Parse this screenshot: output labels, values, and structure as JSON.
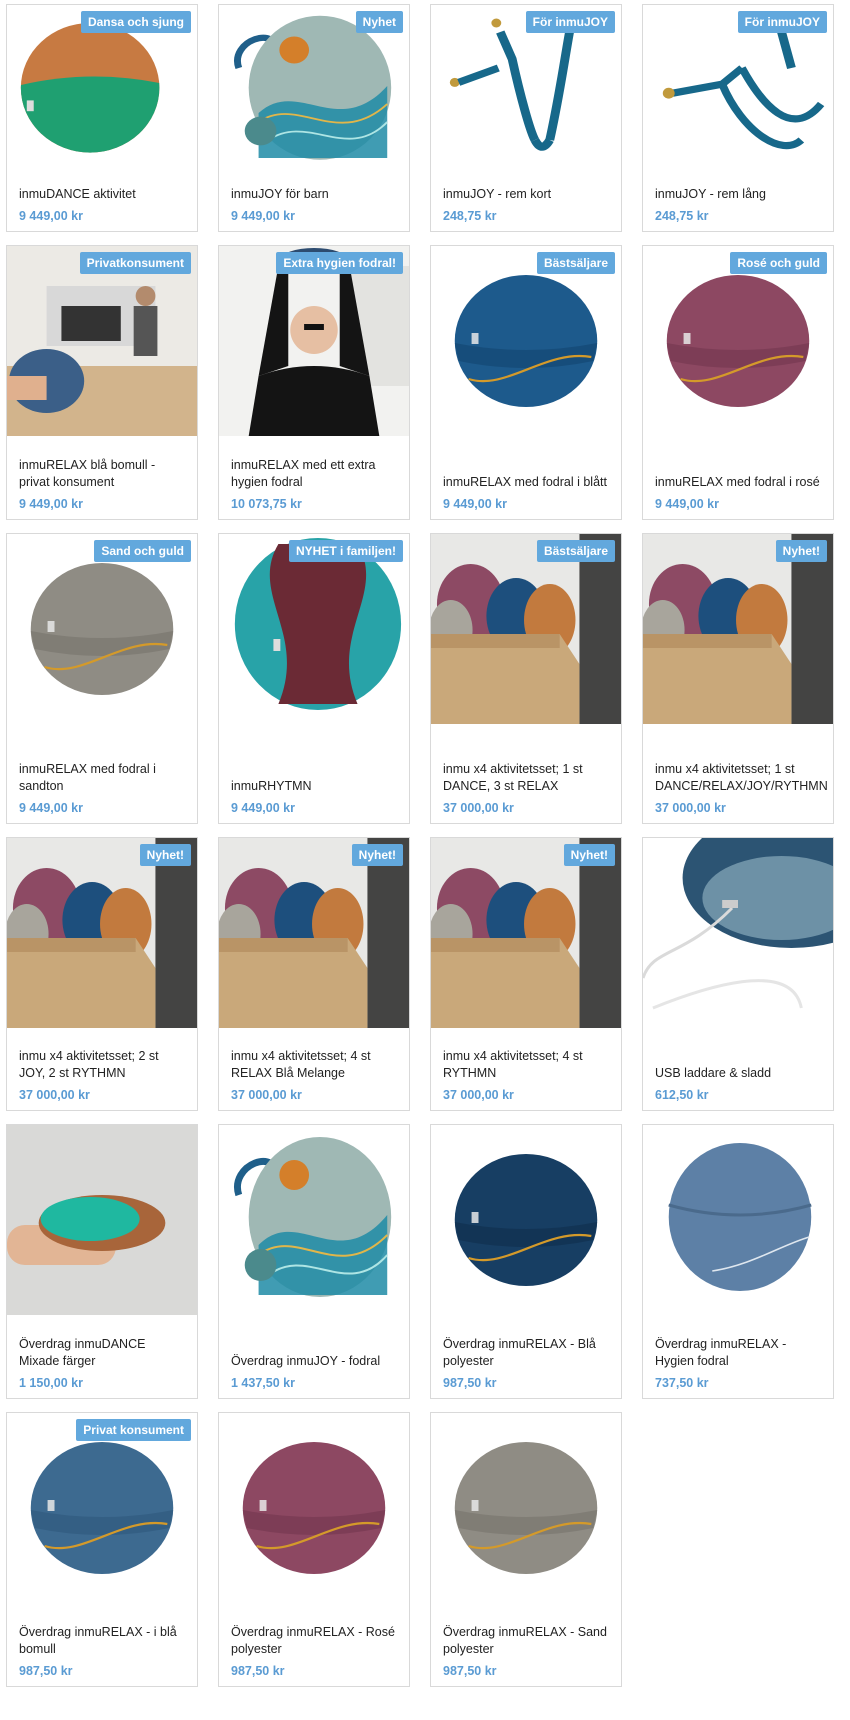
{
  "colors": {
    "badge_bg": "#62a8dd",
    "price": "#5a9bd3"
  },
  "products": [
    {
      "name": "inmuDANCE aktivitet",
      "price": "9 449,00 kr",
      "badge": "Dansa och sjung",
      "image": "dance-cushion"
    },
    {
      "name": "inmuJOY för barn",
      "price": "9 449,00 kr",
      "badge": "Nyhet",
      "image": "joy-cushion"
    },
    {
      "name": "inmuJOY - rem kort",
      "price": "248,75 kr",
      "badge": "För inmuJOY",
      "image": "strap-short"
    },
    {
      "name": "inmuJOY - rem lång",
      "price": "248,75 kr",
      "badge": "För inmuJOY",
      "image": "strap-long"
    },
    {
      "name": "inmuRELAX blå bomull - privat konsument",
      "price": "9 449,00 kr",
      "badge": "Privatkonsument",
      "image": "kitchen-photo"
    },
    {
      "name": "inmuRELAX med ett extra hygien fodral",
      "price": "10 073,75 kr",
      "badge": "Extra hygien fodral!",
      "image": "man-photo"
    },
    {
      "name": "inmuRELAX med fodral i blått",
      "price": "9 449,00 kr",
      "badge": "Bästsäljare",
      "image": "relax-blue"
    },
    {
      "name": "inmuRELAX med fodral i rosé",
      "price": "9 449,00 kr",
      "badge": "Rosé och guld",
      "image": "relax-rose"
    },
    {
      "name": "inmuRELAX med fodral i sandton",
      "price": "9 449,00 kr",
      "badge": "Sand och guld",
      "image": "relax-sand"
    },
    {
      "name": "inmuRHYTMN",
      "price": "9 449,00 kr",
      "badge": "NYHET i familjen!",
      "image": "rhytmn"
    },
    {
      "name": "inmu x4 aktivitetsset; 1 st DANCE, 3 st RELAX",
      "price": "37 000,00 kr",
      "badge": "Bästsäljare",
      "image": "box-set"
    },
    {
      "name": "inmu x4 aktivitetsset; 1 st DANCE/RELAX/JOY/RYTHMN",
      "price": "37 000,00 kr",
      "badge": "Nyhet!",
      "image": "box-set"
    },
    {
      "name": "inmu x4 aktivitetsset; 2 st JOY, 2 st RYTHMN",
      "price": "37 000,00 kr",
      "badge": "Nyhet!",
      "image": "box-set"
    },
    {
      "name": "inmu x4 aktivitetsset; 4 st RELAX Blå Melange",
      "price": "37 000,00 kr",
      "badge": "Nyhet!",
      "image": "box-set"
    },
    {
      "name": "inmu x4 aktivitetsset; 4 st RYTHMN",
      "price": "37 000,00 kr",
      "badge": "Nyhet!",
      "image": "box-set"
    },
    {
      "name": "USB laddare & sladd",
      "price": "612,50 kr",
      "badge": "",
      "image": "usb-cable"
    },
    {
      "name": "Överdrag inmuDANCE Mixade färger",
      "price": "1 150,00 kr",
      "badge": "",
      "image": "hands-dance"
    },
    {
      "name": "Överdrag inmuJOY - fodral",
      "price": "1 437,50 kr",
      "badge": "",
      "image": "joy-cushion"
    },
    {
      "name": "Överdrag inmuRELAX - Blå polyester",
      "price": "987,50 kr",
      "badge": "",
      "image": "relax-navy"
    },
    {
      "name": "Överdrag inmuRELAX - Hygien fodral",
      "price": "737,50 kr",
      "badge": "",
      "image": "hygien-cover"
    },
    {
      "name": "Överdrag inmuRELAX - i blå bomull",
      "price": "987,50 kr",
      "badge": "Privat konsument",
      "image": "relax-denim"
    },
    {
      "name": "Överdrag inmuRELAX - Rosé polyester",
      "price": "987,50 kr",
      "badge": "",
      "image": "relax-rose"
    },
    {
      "name": "Överdrag inmuRELAX - Sand polyester",
      "price": "987,50 kr",
      "badge": "",
      "image": "relax-sand"
    }
  ]
}
